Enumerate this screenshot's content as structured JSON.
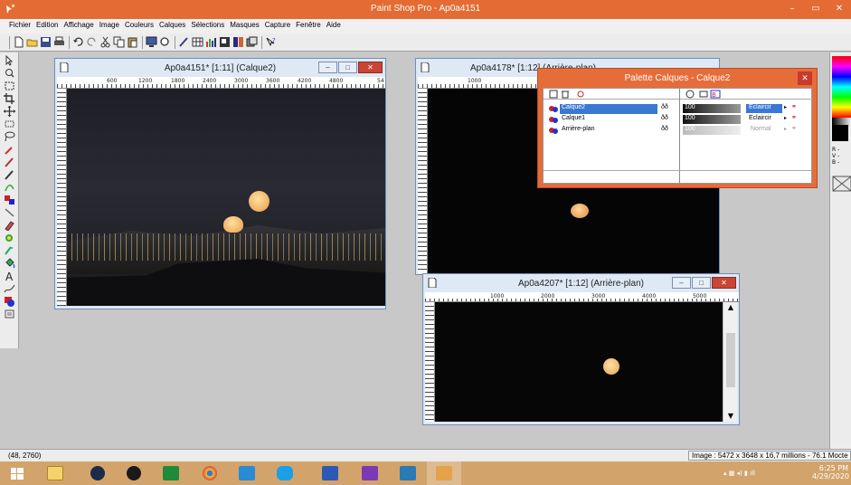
{
  "window": {
    "title": "Paint Shop Pro - Ap0a4151"
  },
  "menu": [
    "Fichier",
    "Edition",
    "Affichage",
    "Image",
    "Couleurs",
    "Calques",
    "Sélections",
    "Masques",
    "Capture",
    "Fenêtre",
    "Aide"
  ],
  "windows": {
    "w1": {
      "title": "Ap0a4151* [1:11] (Calque2)",
      "ruler": [
        "600",
        "1200",
        "1800",
        "2400",
        "3000",
        "3600",
        "4200",
        "4800",
        "54"
      ]
    },
    "w2": {
      "title": "Ap0a4178* [1:12] (Arrière-plan)",
      "ruler": [
        "1000"
      ]
    },
    "w3": {
      "title": "Ap0a4207* [1:12] (Arrière-plan)",
      "ruler": [
        "1000",
        "2000",
        "3000",
        "4000",
        "5000"
      ]
    }
  },
  "palette": {
    "title": "Palette Calques - Calque2",
    "layers": [
      {
        "name": "Calque2",
        "opacity": "100",
        "mode": "Eclaircir",
        "selected": true
      },
      {
        "name": "Calque1",
        "opacity": "100",
        "mode": "Eclaircir",
        "selected": false
      },
      {
        "name": "Arrière-plan",
        "opacity": "100",
        "mode": "Normal",
        "selected": false
      }
    ]
  },
  "rgb": {
    "r": "R -",
    "g": "V -",
    "b": "B -"
  },
  "status": {
    "coords": "(48, 2760)",
    "info": "Image : 5472 x 3648 x 16,7 millions - 76.1 Mocte"
  },
  "clock": {
    "time": "6:25 PM",
    "date": "4/29/2020"
  },
  "colors": {
    "accent": "#e46b34",
    "taskbar": "#d2a46c",
    "moon": "#f2b46a"
  }
}
